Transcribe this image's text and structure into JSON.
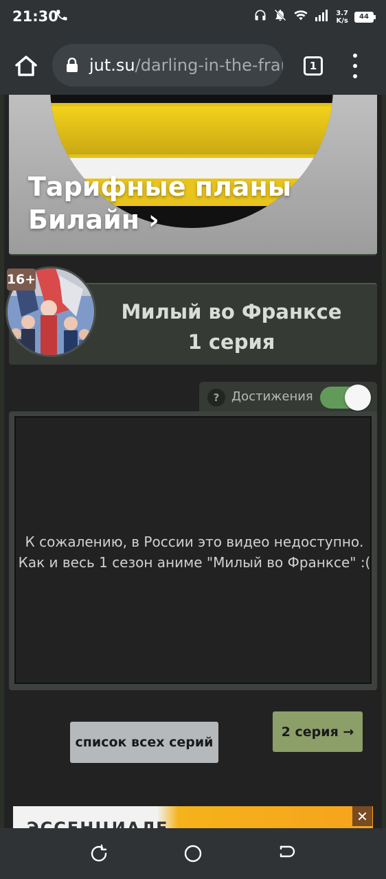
{
  "status_bar": {
    "time": "21:30",
    "phone_icon": "phone-icon",
    "net_speed_value": "3.7",
    "net_speed_unit": "K/s",
    "battery": "44"
  },
  "browser": {
    "url_host": "jut.su",
    "url_path": "/darling-in-the-fran",
    "tab_count": "1"
  },
  "ad_banner": {
    "title_line1": "Тарифные планы",
    "title_line2": "Билайн ›"
  },
  "episode": {
    "age_rating": "16+",
    "title": "Милый во Франксе 1 серия"
  },
  "achievements": {
    "help": "?",
    "label": "Достижения",
    "enabled": true
  },
  "player": {
    "message_line1": "К сожалению, в России это видео недоступно.",
    "message_line2": "Как и весь 1 сезон аниме \"Милый во Франксе\" :("
  },
  "buttons": {
    "all_episodes": "список всех серий",
    "next_episode": "2 серия →"
  },
  "bottom_ad": {
    "text": "ЭССЕНЦИАЛЕ",
    "close": "✕"
  },
  "colors": {
    "background": "#222222",
    "toggle_on": "#629a59",
    "next_button": "#8d9f69",
    "list_button": "#b6b9bb"
  }
}
